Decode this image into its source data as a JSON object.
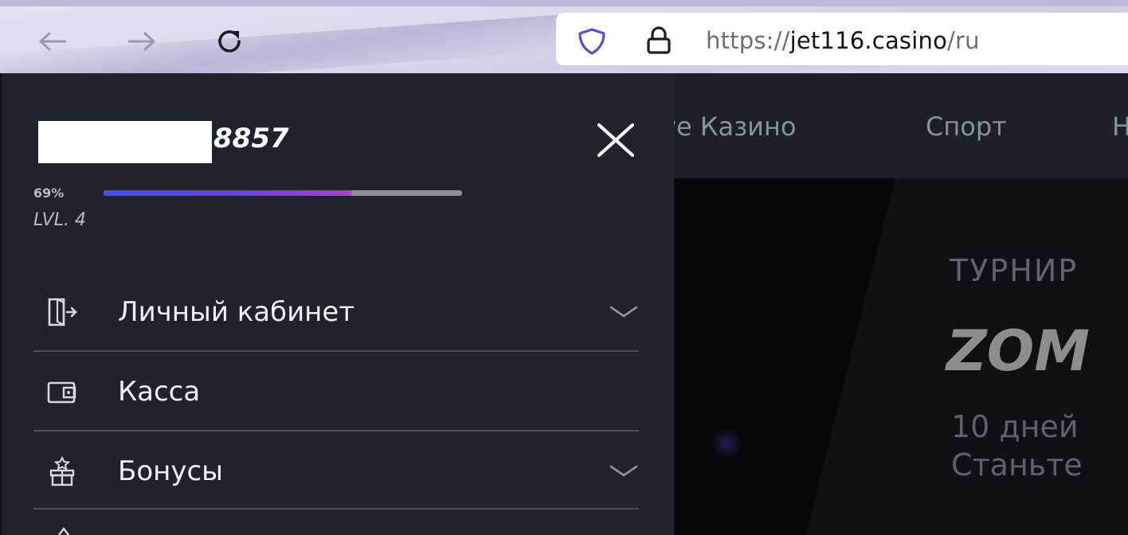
{
  "browser": {
    "url_scheme": "https://",
    "url_host": "jet116.casino",
    "url_path": "/ru",
    "icons": {
      "back": "arrow-left-icon",
      "forward": "arrow-right-icon",
      "reload": "reload-icon",
      "tracking": "shield-icon",
      "security": "lock-icon"
    }
  },
  "page": {
    "nav": [
      {
        "label": "ve Казино"
      },
      {
        "label": "Спорт"
      },
      {
        "label": "Н"
      }
    ],
    "hero": {
      "label": "ТУРНИР",
      "title": "ZOM",
      "line1": "10 дней",
      "line2": "Станьте"
    }
  },
  "drawer": {
    "username_suffix": "8857",
    "progress": {
      "percent_label": "69%",
      "value": 0.69
    },
    "level_label": "LVL. 4",
    "menu": [
      {
        "label": "Личный кабинет",
        "icon": "door-exit-icon",
        "expandable": true
      },
      {
        "label": "Касса",
        "icon": "wallet-icon",
        "expandable": false
      },
      {
        "label": "Бонусы",
        "icon": "gift-icon",
        "expandable": true
      }
    ],
    "colors": {
      "background": "#1f242c",
      "progress_start": "#3c4ff0",
      "progress_end": "#b23bd9"
    }
  }
}
